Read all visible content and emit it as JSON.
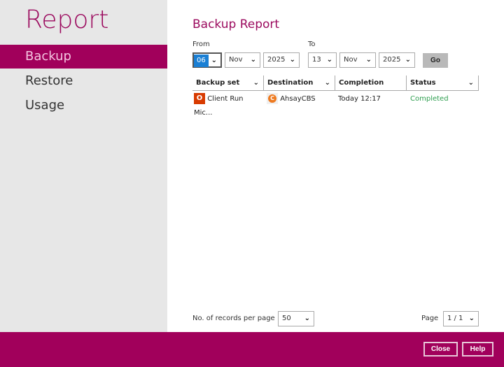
{
  "sidebar": {
    "title": "Report",
    "items": [
      {
        "label": "Backup",
        "active": true
      },
      {
        "label": "Restore"
      },
      {
        "label": "Usage"
      }
    ]
  },
  "main": {
    "title": "Backup Report",
    "from": {
      "label": "From",
      "day": "06",
      "month": "Nov",
      "year": "2025"
    },
    "to": {
      "label": "To",
      "day": "13",
      "month": "Nov",
      "year": "2025"
    },
    "go_label": "Go",
    "columns": [
      "Backup set",
      "Destination",
      "Completion",
      "Status"
    ],
    "rows": [
      {
        "backup_set": "Client Run Mic...",
        "destination": "AhsayCBS",
        "completion": "Today 12:17",
        "status": "Completed"
      }
    ],
    "records_label": "No. of records per page",
    "records_value": "50",
    "page_label": "Page",
    "page_value": "1 / 1"
  },
  "footer": {
    "close_label": "Close",
    "help_label": "Help"
  },
  "colors": {
    "accent": "#a1005b",
    "status_ok": "#2e9e4f"
  }
}
